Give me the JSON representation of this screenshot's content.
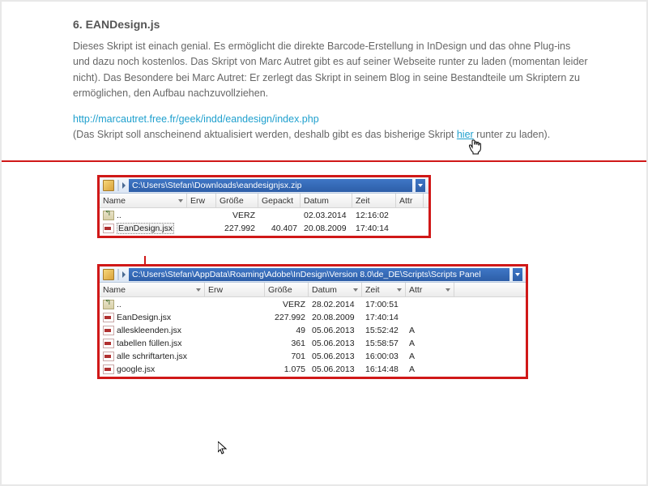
{
  "article": {
    "heading": "6. EANDesign.js",
    "para1": "Dieses Skript ist einach genial. Es ermöglicht die direkte Barcode-Erstellung in InDesign und das ohne Plug-ins und dazu noch kostenlos. Das Skript von Marc Autret gibt es auf seiner Webseite runter zu laden (momentan leider nicht). Das Besondere bei Marc Autret: Er zerlegt das Skript in seinem Blog in seine Bestandteile um Skriptern zu ermöglichen, den Aufbau nachzuvollziehen.",
    "url": "http://marcautret.free.fr/geek/indd/eandesign/index.php",
    "para2_pre": "(Das Skript soll anscheinend aktualisiert werden, deshalb gibt es das bisherige Skript ",
    "para2_link": "hier",
    "para2_post": " runter zu laden)."
  },
  "archive": {
    "path": "C:\\Users\\Stefan\\Downloads\\eandesignjsx.zip",
    "headers": {
      "name": "Name",
      "erw": "Erw",
      "size": "Größe",
      "packed": "Gepackt",
      "date": "Datum",
      "time": "Zeit",
      "attr": "Attr"
    },
    "rows": [
      {
        "up": true,
        "name": "..",
        "erw": "",
        "size": "VERZ",
        "packed": "",
        "date": "02.03.2014",
        "time": "12:16:02",
        "attr": ""
      },
      {
        "up": false,
        "sel": true,
        "name": "EanDesign.jsx",
        "erw": "",
        "size": "227.992",
        "packed": "40.407",
        "date": "20.08.2009",
        "time": "17:40:14",
        "attr": ""
      }
    ]
  },
  "panel": {
    "path": "C:\\Users\\Stefan\\AppData\\Roaming\\Adobe\\InDesign\\Version 8.0\\de_DE\\Scripts\\Scripts Panel",
    "headers": {
      "name": "Name",
      "erw": "Erw",
      "size": "Größe",
      "date": "Datum",
      "time": "Zeit",
      "attr": "Attr"
    },
    "rows": [
      {
        "up": true,
        "name": "..",
        "size": "VERZ",
        "date": "28.02.2014",
        "time": "17:00:51",
        "attr": ""
      },
      {
        "up": false,
        "name": "EanDesign.jsx",
        "size": "227.992",
        "date": "20.08.2009",
        "time": "17:40:14",
        "attr": ""
      },
      {
        "up": false,
        "name": "alleskleenden.jsx",
        "size": "49",
        "date": "05.06.2013",
        "time": "15:52:42",
        "attr": "A"
      },
      {
        "up": false,
        "name": "tabellen füllen.jsx",
        "size": "361",
        "date": "05.06.2013",
        "time": "15:58:57",
        "attr": "A"
      },
      {
        "up": false,
        "name": "alle schriftarten.jsx",
        "size": "701",
        "date": "05.06.2013",
        "time": "16:00:03",
        "attr": "A"
      },
      {
        "up": false,
        "name": "google.jsx",
        "size": "1.075",
        "date": "05.06.2013",
        "time": "16:14:48",
        "attr": "A"
      }
    ]
  }
}
